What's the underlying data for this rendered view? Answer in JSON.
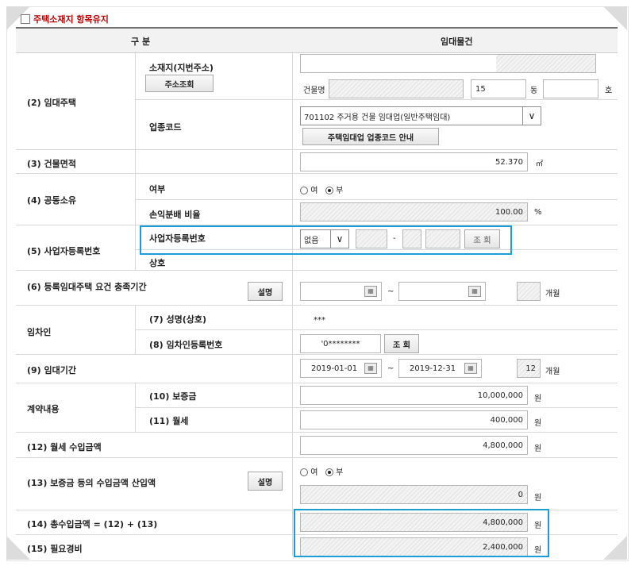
{
  "section_title": "주택소재지 항목유지",
  "header": {
    "col1": "구     분",
    "col2": "임대물건"
  },
  "rows": {
    "r2": {
      "label": "(2) 임대주택",
      "sub_location": "소재지(지번주소)",
      "btn_address": "주소조회",
      "building_label": "건물명",
      "dong_value": "15",
      "dong_unit": "동",
      "ho_unit": "호",
      "sub_industry": "업종코드",
      "industry_select": "701102 주거용 건물 임대업(일반주택임대)",
      "btn_industry_guide": "주택임대업 업종코드 안내"
    },
    "r3": {
      "label": "(3) 건물면적",
      "value": "52.370",
      "unit": "㎡"
    },
    "r4": {
      "label": "(4) 공동소유",
      "sub_whether": "여부",
      "opt_yes": "여",
      "opt_no": "부",
      "sub_ratio": "손익분배 비율",
      "ratio_value": "100.00",
      "ratio_unit": "%"
    },
    "r5": {
      "label": "(5) 사업자등록번호",
      "sub_regno": "사업자등록번호",
      "select_value": "없음",
      "dash1": "-",
      "dash2": "-",
      "btn_lookup": "조 회",
      "sub_trade": "상호"
    },
    "r6": {
      "label": "(6) 등록임대주택 요건 충족기간",
      "btn_explain": "설명",
      "tilde": "~",
      "unit": "개월"
    },
    "tenant": {
      "label": "임차인",
      "sub_name": "(7) 성명(상호)",
      "name_value": "***",
      "sub_regno": "(8) 임차인등록번호",
      "regno_value": "'0********",
      "btn_lookup": "조 회"
    },
    "r9": {
      "label": "(9) 임대기간",
      "start": "2019-01-01",
      "tilde": "~",
      "end": "2019-12-31",
      "months": "12",
      "unit": "개월"
    },
    "contract": {
      "label": "계약내용",
      "sub_deposit": "(10) 보증금",
      "deposit_value": "10,000,000",
      "sub_rent": "(11) 월세",
      "rent_value": "400,000",
      "unit": "원"
    },
    "r12": {
      "label": "(12) 월세 수입금액",
      "value": "4,800,000",
      "unit": "원"
    },
    "r13": {
      "label": "(13) 보증금 등의 수입금액 산입액",
      "btn_explain": "설명",
      "opt_yes": "여",
      "opt_no": "부",
      "value": "0",
      "unit": "원"
    },
    "r14": {
      "label": "(14) 총수입금액 = (12) + (13)",
      "value": "4,800,000",
      "unit": "원"
    },
    "r15": {
      "label": "(15) 필요경비",
      "value": "2,400,000",
      "unit": "원"
    }
  },
  "colors": {
    "highlight": "#1a9ed8",
    "title_red": "#c00000"
  }
}
